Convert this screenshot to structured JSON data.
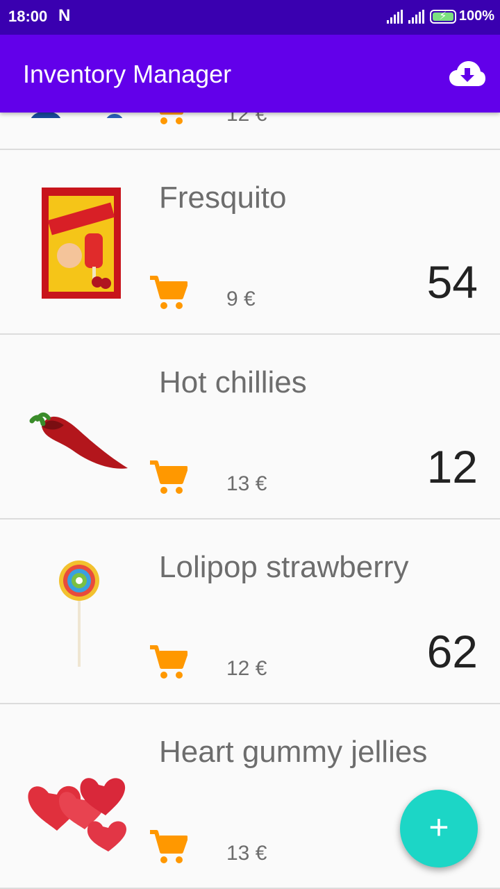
{
  "status_bar": {
    "time": "18:00",
    "notification_icon": "N",
    "battery_percent": "100%"
  },
  "app_bar": {
    "title": "Inventory Manager",
    "action_icon": "cloud-download-icon"
  },
  "products": [
    {
      "name": "",
      "price": "12 €",
      "quantity": "",
      "image": "blue-gummy-image"
    },
    {
      "name": "Fresquito",
      "price": "9 €",
      "quantity": "54",
      "image": "fresquito-package-image"
    },
    {
      "name": "Hot chillies",
      "price": "13 €",
      "quantity": "12",
      "image": "hot-chilli-image"
    },
    {
      "name": "Lolipop strawberry",
      "price": "12 €",
      "quantity": "62",
      "image": "lollipop-image"
    },
    {
      "name": "Heart gummy jellies",
      "price": "13 €",
      "quantity": "",
      "image": "heart-jellies-image"
    }
  ],
  "fab": {
    "label": "+"
  },
  "colors": {
    "status_bar": "#3a00b0",
    "app_bar": "#6200ea",
    "cart_icon": "#ff9800",
    "fab": "#1cd6c6"
  }
}
